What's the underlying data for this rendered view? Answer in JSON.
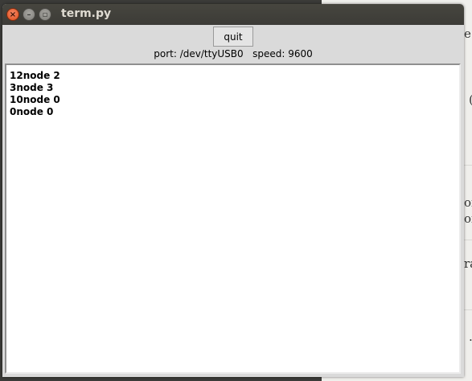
{
  "window": {
    "title": "term.py",
    "controls": {
      "close_icon": "close-icon",
      "minimize_icon": "minimize-icon",
      "maximize_icon": "maximize-icon"
    }
  },
  "toolbar": {
    "quit_label": "quit"
  },
  "status": {
    "port_label": "port: /dev/ttyUSB0",
    "speed_label": "speed: 9600"
  },
  "terminal": {
    "lines": [
      "12node 2",
      "3node 3",
      "10node 0",
      "0node 0"
    ]
  },
  "background_page": {
    "fragments": [
      "e",
      "(",
      "oi",
      "oi",
      "ra",
      "."
    ]
  },
  "colors": {
    "titlebar": "#3c3b37",
    "close_button": "#df4b16",
    "window_bg": "#dadada"
  }
}
